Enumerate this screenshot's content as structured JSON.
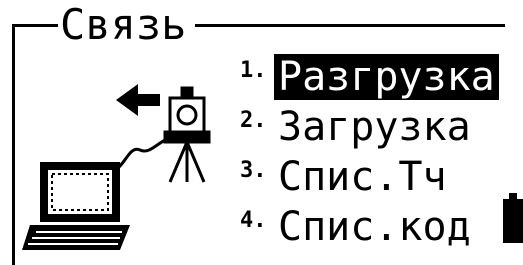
{
  "screen": {
    "title": "Связь",
    "menu": [
      {
        "num": "1.",
        "label": "Разгрузка",
        "selected": true
      },
      {
        "num": "2.",
        "label": "Загрузка",
        "selected": false
      },
      {
        "num": "3.",
        "label": "Спис.Тч",
        "selected": false
      },
      {
        "num": "4.",
        "label": "Спис.код",
        "selected": false
      }
    ],
    "icons": [
      "laptop-icon",
      "arrow-left-icon",
      "total-station-icon",
      "battery-icon"
    ]
  }
}
